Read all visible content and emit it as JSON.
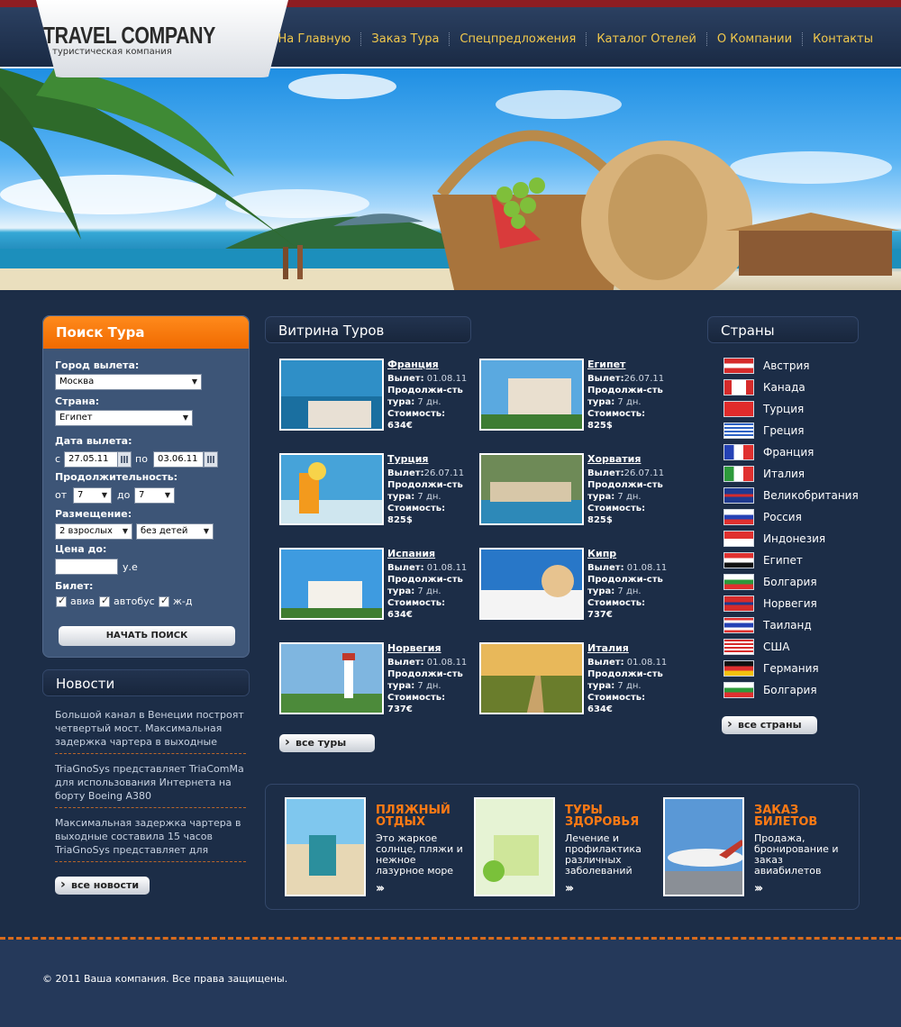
{
  "header": {
    "logo_title": "TRAVEL COMPANY",
    "logo_subtitle": "туристическая компания",
    "nav": [
      "На Главную",
      "Заказ Тура",
      "Спецпредложения",
      "Каталог Отелей",
      "О Компании",
      "Контакты"
    ]
  },
  "search": {
    "title": "Поиск Тура",
    "city_label": "Город вылета:",
    "city_value": "Москва",
    "country_label": "Страна:",
    "country_value": "Египет",
    "date_label": "Дата вылета:",
    "date_from_prefix": "с",
    "date_from": "27.05.11",
    "date_to_prefix": "по",
    "date_to": "03.06.11",
    "duration_label": "Продолжительность:",
    "duration_from_prefix": "от",
    "duration_from": "7",
    "duration_to_prefix": "до",
    "duration_to": "7",
    "accommodation_label": "Размещение:",
    "adults_value": "2 взрослых",
    "children_value": "без детей",
    "price_label": "Цена до:",
    "price_value": "",
    "price_unit": "у.е",
    "ticket_label": "Билет:",
    "ticket_options": [
      "авиа",
      "автобус",
      "ж-д"
    ],
    "submit_label": "НАЧАТЬ ПОИСК"
  },
  "news": {
    "title": "Новости",
    "items": [
      "Большой канал в Венеции построят четвертый мост. Максимальная задержка чартера в выходные",
      "TriaGnoSys представляет TriaComMa для использования Интернета на борту Boeing A380",
      "Максимальная задержка чартера в выходные составила 15 часов TriaGnoSys представляет для"
    ],
    "all_label": "все новости"
  },
  "tours": {
    "title": "Витрина Туров",
    "departure_label": "Вылет:",
    "duration_label": "Продолжи-сть тура:",
    "price_label": "Стоимость:",
    "items": [
      {
        "name": "Франция",
        "date": "01.08.11",
        "duration": "7 дн.",
        "price": "634€"
      },
      {
        "name": "Египет",
        "date": "26.07.11",
        "duration": "7 дн.",
        "price": "825$"
      },
      {
        "name": "Турция",
        "date": "26.07.11",
        "duration": "7 дн.",
        "price": "825$"
      },
      {
        "name": "Хорватия",
        "date": "26.07.11",
        "duration": "7 дн.",
        "price": "825$"
      },
      {
        "name": "Испания",
        "date": "01.08.11",
        "duration": "7 дн.",
        "price": "634€"
      },
      {
        "name": "Кипр",
        "date": "01.08.11",
        "duration": "7 дн.",
        "price": "737€"
      },
      {
        "name": "Норвегия",
        "date": "01.08.11",
        "duration": "7 дн.",
        "price": "737€"
      },
      {
        "name": "Италия",
        "date": "01.08.11",
        "duration": "7 дн.",
        "price": "634€"
      }
    ],
    "all_label": "все туры"
  },
  "countries": {
    "title": "Страны",
    "items": [
      "Австрия",
      "Канада",
      "Турция",
      "Греция",
      "Франция",
      "Италия",
      "Великобритания",
      "Россия",
      "Индонезия",
      "Египет",
      "Болгария",
      "Норвегия",
      "Таиланд",
      "США",
      "Германия",
      "Болгария"
    ],
    "all_label": "все страны"
  },
  "promos": [
    {
      "title_1": "ПЛЯЖНЫЙ",
      "title_2": "ОТДЫХ",
      "text": "Это жаркое солнце, пляжи и нежное лазурное море"
    },
    {
      "title_1": "ТУРЫ",
      "title_2": "ЗДОРОВЬЯ",
      "text": "Лечение и профилактика различных заболеваний"
    },
    {
      "title_1": "ЗАКАЗ",
      "title_2": "БИЛЕТОВ",
      "text": "Продажа, бронирование и заказ авиабилетов"
    }
  ],
  "footer": {
    "copyright": "© 2011  Ваша компания. Все права защищены."
  },
  "colors": {
    "background": "#1c2d47",
    "accent_orange": "#f06a00",
    "nav_text": "#f2c94c",
    "header_red": "#8d1d22"
  }
}
